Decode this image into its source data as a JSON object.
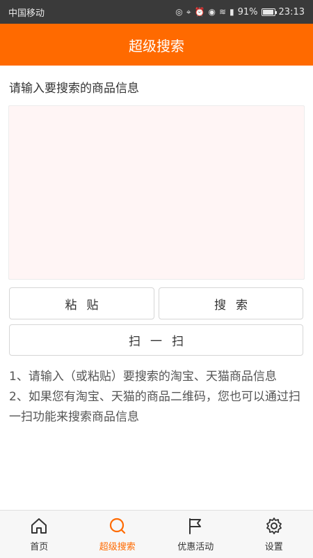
{
  "status_bar": {
    "carrier": "中国移动",
    "battery": "91%",
    "time": "23:13"
  },
  "header": {
    "title": "超级搜索"
  },
  "main": {
    "prompt": "请输入要搜索的商品信息",
    "textarea_value": "",
    "paste_label": "粘贴",
    "search_label": "搜索",
    "scan_label": "扫一扫",
    "tip1": "1、请输入（或粘贴）要搜索的淘宝、天猫商品信息",
    "tip2": "2、如果您有淘宝、天猫的商品二维码，您也可以通过扫一扫功能来搜索商品信息"
  },
  "bottom_nav": {
    "items": [
      {
        "label": "首页",
        "icon": "home-icon"
      },
      {
        "label": "超级搜索",
        "icon": "search-icon",
        "active": true
      },
      {
        "label": "优惠活动",
        "icon": "flag-icon"
      },
      {
        "label": "设置",
        "icon": "gear-icon"
      }
    ]
  },
  "colors": {
    "accent": "#ff6a00",
    "status_bar": "#3a3a3a",
    "textarea_bg": "#fff5f5"
  }
}
